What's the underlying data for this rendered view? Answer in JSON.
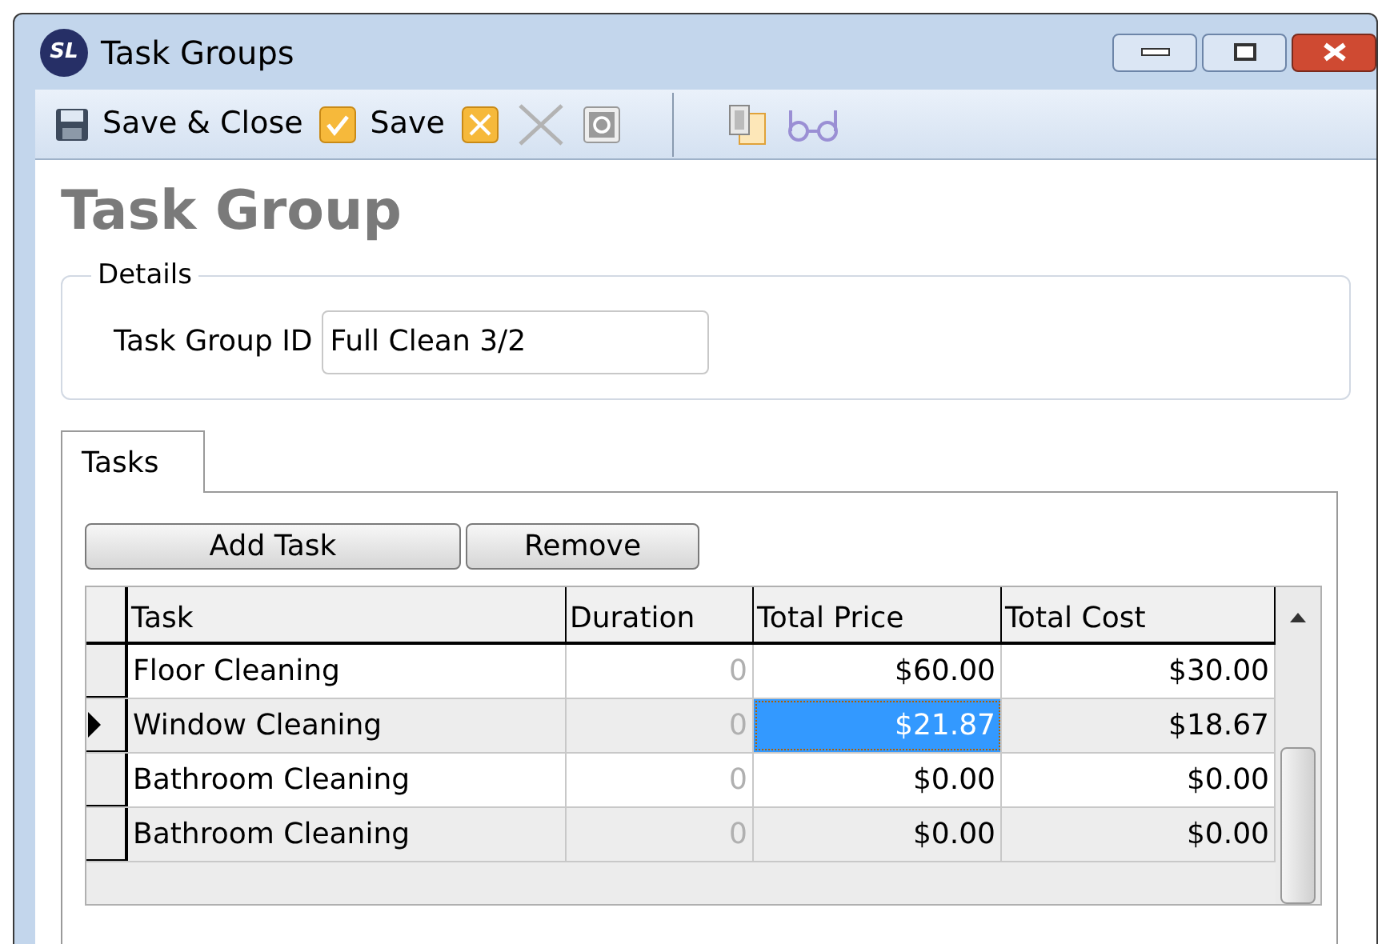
{
  "window": {
    "logo": "SL",
    "title": "Task Groups"
  },
  "toolbar": [
    {
      "kind": "save-close",
      "label": "Save & Close",
      "disabled": false
    },
    {
      "kind": "save",
      "label": "Save",
      "disabled": false
    },
    {
      "kind": "cancel",
      "disabled": false
    },
    {
      "kind": "delete",
      "disabled": true
    },
    {
      "kind": "refresh",
      "disabled": true
    },
    {
      "kind": "separator"
    },
    {
      "kind": "copy",
      "disabled": false
    },
    {
      "kind": "view",
      "disabled": false
    }
  ],
  "heading": "Task Group",
  "details": {
    "legend": "Details",
    "label": "Task Group ID",
    "value": "Full Clean 3/2"
  },
  "tabs": [
    {
      "label": "Tasks",
      "selected": true
    }
  ],
  "buttons": [
    "Add Task",
    "Remove"
  ],
  "table": {
    "columns": [
      "Task",
      "Duration",
      "Total Price",
      "Total Cost"
    ],
    "rows": [
      {
        "selected": false,
        "cells": [
          {
            "text": "Floor Cleaning",
            "focused": false
          },
          {
            "text": "0",
            "focused": false
          },
          {
            "text": "$60.00",
            "focused": false
          },
          {
            "text": "$30.00",
            "focused": false
          }
        ]
      },
      {
        "selected": true,
        "cells": [
          {
            "text": "Window Cleaning",
            "focused": false
          },
          {
            "text": "0",
            "focused": false
          },
          {
            "text": "$21.87",
            "focused": true
          },
          {
            "text": "$18.67",
            "focused": false
          }
        ]
      },
      {
        "selected": false,
        "cells": [
          {
            "text": "Bathroom Cleaning",
            "focused": false
          },
          {
            "text": "0",
            "focused": false
          },
          {
            "text": "$0.00",
            "focused": false
          },
          {
            "text": "$0.00",
            "focused": false
          }
        ]
      },
      {
        "selected": false,
        "cells": [
          {
            "text": "Bathroom Cleaning",
            "focused": false
          },
          {
            "text": "0",
            "focused": false
          },
          {
            "text": "$0.00",
            "focused": false
          },
          {
            "text": "$0.00",
            "focused": false
          }
        ]
      }
    ]
  }
}
